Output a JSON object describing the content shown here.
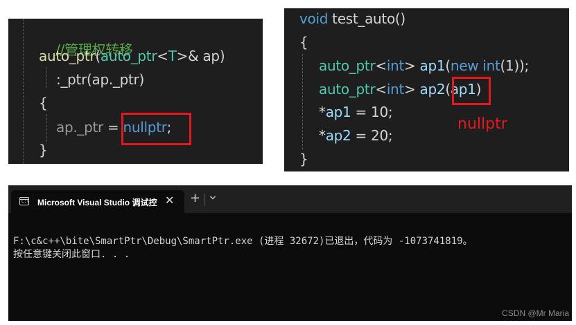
{
  "left_code": {
    "comment": "//管理权转移",
    "line2": {
      "fn": "auto_ptr",
      "open": "(",
      "type": "auto_ptr",
      "lt": "<",
      "tparam": "T",
      "rest": ">& ap)"
    },
    "line3": {
      "init": ":_ptr(ap._ptr)"
    },
    "line4": "{",
    "line5": {
      "lhs": "ap._ptr",
      "eq": " = ",
      "kw": "nullptr",
      "semi": ";"
    },
    "line6": "}"
  },
  "right_code": {
    "line1": {
      "kw": "void",
      "fn": " test_auto()"
    },
    "line2": "{",
    "line3": {
      "type": "auto_ptr",
      "lt": "<",
      "tkw": "int",
      "gt": "> ",
      "var": "ap1",
      "open": "(",
      "newkw": "new",
      "sp": " ",
      "intkw": "int",
      "num": "(1)",
      "close": ");"
    },
    "line4": {
      "type": "auto_ptr",
      "lt": "<",
      "tkw": "int",
      "gt": "> ",
      "var": "ap2",
      "open": "(",
      "arg": "ap1",
      "close": ")"
    },
    "line5": {
      "star": "*",
      "var": "ap1",
      "rest": " = 10;"
    },
    "line6": {
      "star": "*",
      "var": "ap2",
      "rest": " = 20;"
    },
    "line7": "}",
    "annotation": "nullptr"
  },
  "terminal": {
    "tab_title": "Microsoft Visual Studio 调试控",
    "tab_icon_text": "C:\\",
    "close_glyph": "✕",
    "new_tab_glyph": "+",
    "output_line1": "F:\\c&c++\\bite\\SmartPtr\\Debug\\SmartPtr.exe (进程 32672)已退出，代码为 -1073741819。",
    "output_line2": "按任意键关闭此窗口. . ."
  },
  "watermark": "CSDN @Mr Maria",
  "colors": {
    "editor_bg": "#1e1e1e",
    "terminal_bg": "#0c0c0c",
    "highlight_red": "#e8171b",
    "comment_green": "#57a64a",
    "type_teal": "#4ec9b0",
    "keyword_blue": "#569cd6"
  }
}
